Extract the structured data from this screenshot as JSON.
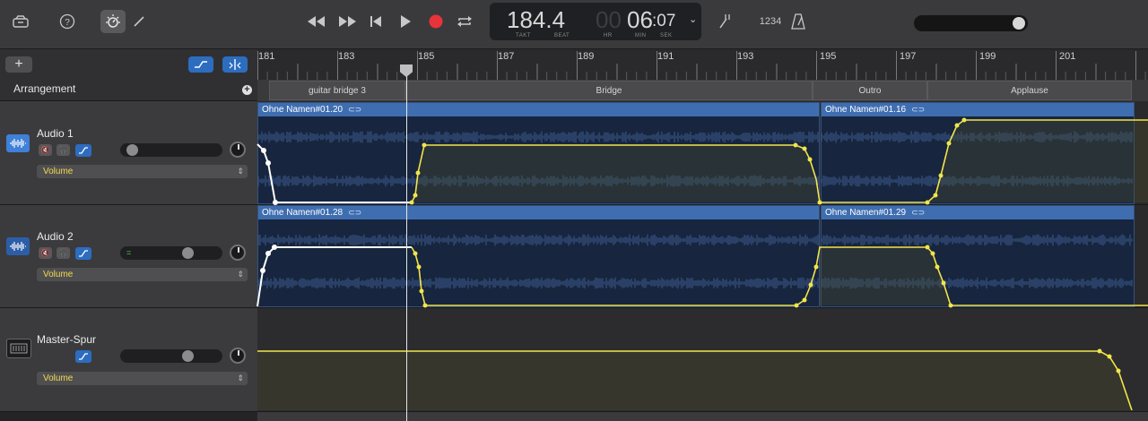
{
  "toolbar": {
    "lcd": {
      "position": "184.4",
      "position_labels": [
        "TAKT",
        "BEAT"
      ],
      "time_dim": "00",
      "time_main": "06",
      "time_sec": ":07",
      "time_labels": [
        "HR",
        "MIN",
        "SEK"
      ]
    },
    "count_in": "1234",
    "master_volume_level": 0.93
  },
  "arrangement": {
    "title": "Arrangement",
    "markers": [
      "guitar bridge 3",
      "Bridge",
      "Outro",
      "Applause"
    ]
  },
  "ruler": {
    "bars": [
      "181",
      "183",
      "185",
      "187",
      "189",
      "191",
      "193",
      "195",
      "197",
      "199",
      "201"
    ]
  },
  "tracks": [
    {
      "name": "Audio 1",
      "automation": "Volume",
      "volume_level": 0.05,
      "regions": [
        "Ohne Namen#01.20",
        "Ohne Namen#01.16"
      ]
    },
    {
      "name": "Audio 2",
      "automation": "Volume",
      "volume_level": 0.7,
      "regions": [
        "Ohne Namen#01.28",
        "Ohne Namen#01.29"
      ]
    },
    {
      "name": "Master-Spur",
      "automation": "Volume",
      "volume_level": 0.7,
      "regions": []
    }
  ],
  "colors": {
    "automation_line": "#f2e54a",
    "region_header": "#3f6eb0",
    "accent": "#2d6dc0"
  }
}
